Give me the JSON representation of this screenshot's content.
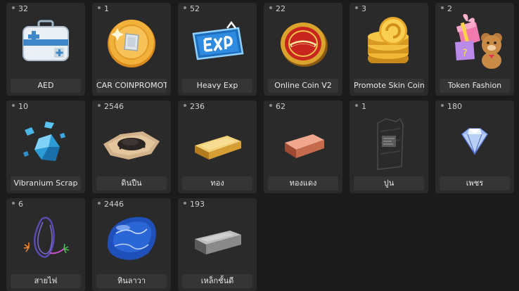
{
  "items": [
    {
      "count": "32",
      "name": "AED",
      "icon": "aed-kit-icon"
    },
    {
      "count": "1",
      "name": "CAR COINPROMOTE",
      "icon": "gold-coin-icon"
    },
    {
      "count": "52",
      "name": "Heavy Exp",
      "icon": "exp-ticket-icon"
    },
    {
      "count": "22",
      "name": "Online Coin V2",
      "icon": "online-coin-icon"
    },
    {
      "count": "3",
      "name": "Promote Skin Coin",
      "icon": "coin-stack-icon"
    },
    {
      "count": "2",
      "name": "Token Fashion",
      "icon": "gift-box-bear-icon"
    },
    {
      "count": "10",
      "name": "Vibranium Scrap",
      "icon": "blue-crystal-icon"
    },
    {
      "count": "2546",
      "name": "ดินปืน",
      "icon": "gunpowder-icon"
    },
    {
      "count": "236",
      "name": "ทอง",
      "icon": "gold-bar-icon"
    },
    {
      "count": "62",
      "name": "ทองแดง",
      "icon": "copper-bar-icon"
    },
    {
      "count": "1",
      "name": "ปูน",
      "icon": "cement-bag-icon"
    },
    {
      "count": "180",
      "name": "เพชร",
      "icon": "diamond-icon"
    },
    {
      "count": "6",
      "name": "สายไฟ",
      "icon": "wire-coil-icon"
    },
    {
      "count": "2446",
      "name": "หินลาวา",
      "icon": "lava-stone-icon"
    },
    {
      "count": "193",
      "name": "เหล็กชั้นดี",
      "icon": "steel-bar-icon"
    }
  ]
}
